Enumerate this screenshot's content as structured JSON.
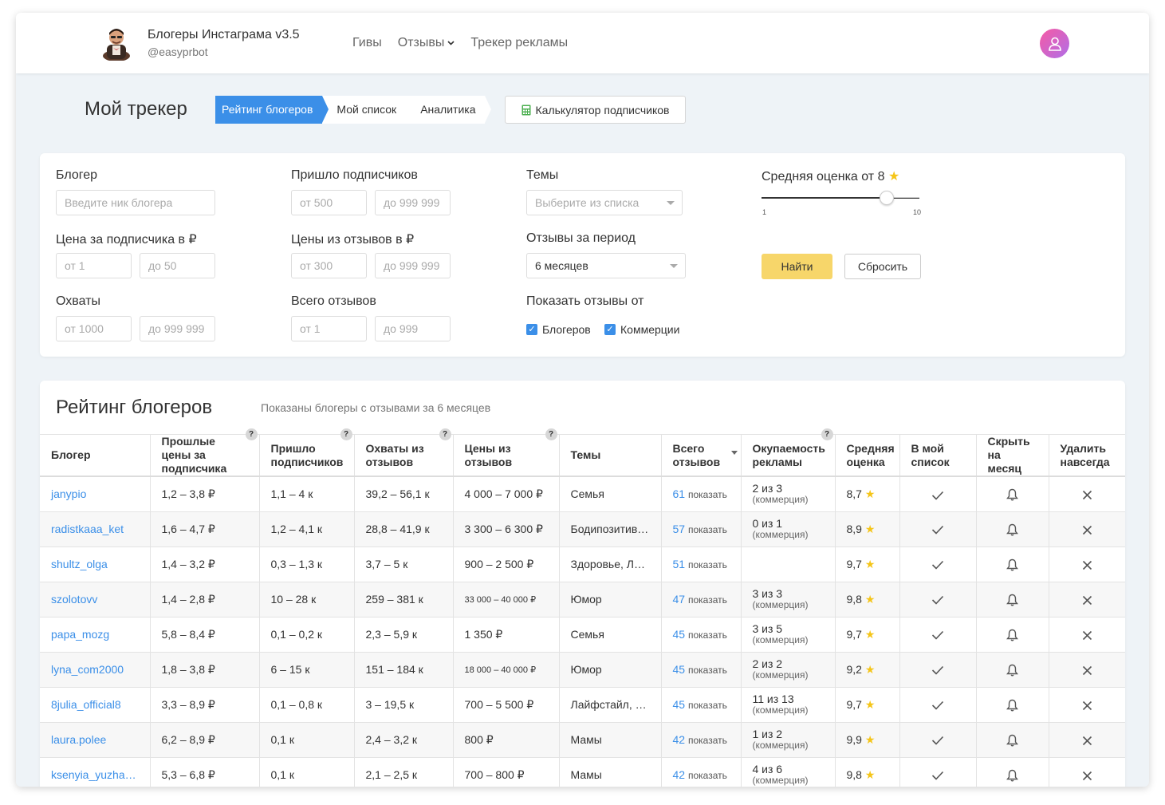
{
  "brand": {
    "title": "Блогеры Инстаграма v3.5",
    "subtitle": "@easyprbot"
  },
  "nav": {
    "items": [
      {
        "label": "Гивы",
        "dropdown": false
      },
      {
        "label": "Отзывы",
        "dropdown": true
      },
      {
        "label": "Трекер рекламы",
        "dropdown": false
      }
    ]
  },
  "page": {
    "title": "Мой трекер",
    "tabs": [
      "Рейтинг блогеров",
      "Мой список",
      "Аналитика"
    ],
    "active_tab": "Рейтинг блогеров",
    "calculator_label": "Калькулятор подписчиков"
  },
  "filters": {
    "blogger_label": "Блогер",
    "blogger_placeholder": "Введите ник блогера",
    "subs_label": "Пришло подписчиков",
    "subs_from": "от 500",
    "subs_to": "до 999 999",
    "themes_label": "Темы",
    "themes_placeholder": "Выберите из списка",
    "avg_label": "Средняя оценка от",
    "avg_value": "8",
    "slider_min": "1",
    "slider_max": "10",
    "slider_value": 8,
    "price_label": "Цена за подписчика в ₽",
    "price_from": "от 1",
    "price_to": "до 50",
    "review_price_label": "Цены из отзывов в ₽",
    "review_price_from": "от 300",
    "review_price_to": "до 999 999",
    "period_label": "Отзывы за период",
    "period_value": "6 месяцев",
    "find_label": "Найти",
    "reset_label": "Сбросить",
    "reach_label": "Охваты",
    "reach_from": "от 1000",
    "reach_to": "до 999 999",
    "total_label": "Всего отзывов",
    "total_from": "от 1",
    "total_to": "до 999",
    "show_from_label": "Показать отзывы от",
    "chk_bloggers": "Блогеров",
    "chk_commerce": "Коммерции"
  },
  "rating": {
    "title": "Рейтинг блогеров",
    "subtitle": "Показаны блогеры с отзывами за 6 месяцев",
    "columns": [
      "Блогер",
      "Прошлые цены за подписчика",
      "Пришло подписчиков",
      "Охваты из отзывов",
      "Цены из отзывов",
      "Темы",
      "Всего отзывов",
      "Окупаемость рекламы",
      "Средняя оценка",
      "В мой список",
      "Скрыть на месяц",
      "Удалить навсегда"
    ],
    "show_label": "показать",
    "commerce_label": "(коммерция)",
    "rows": [
      {
        "blogger": "janypio",
        "past_price": "1,2 – 3,8 ₽",
        "subs": "1,1 – 4 к",
        "reach": "39,2 – 56,1 к",
        "prices": "4 000 – 7 000 ₽",
        "theme": "Семья",
        "total": "61",
        "roi": "2 из 3",
        "score": "8,7"
      },
      {
        "blogger": "radistkaaa_ket",
        "past_price": "1,6 – 4,7 ₽",
        "subs": "1,2 – 4,1 к",
        "reach": "28,8 – 41,9 к",
        "prices": "3 300 – 6 300 ₽",
        "theme": "Бодипозитив…",
        "total": "57",
        "roi": "0 из 1",
        "score": "8,9"
      },
      {
        "blogger": "shultz_olga",
        "past_price": "1,4 – 3,2 ₽",
        "subs": "0,3 – 1,3 к",
        "reach": "3,7 – 5 к",
        "prices": "900 – 2 500 ₽",
        "theme": "Здоровье, Ла…",
        "total": "51",
        "roi": "",
        "score": "9,7"
      },
      {
        "blogger": "szolotovv",
        "past_price": "1,4 – 2,8 ₽",
        "subs": "10 – 28 к",
        "reach": "259 – 381 к",
        "prices": "33 000 – 40 000 ₽",
        "theme": "Юмор",
        "total": "47",
        "roi": "3 из 3",
        "score": "9,8"
      },
      {
        "blogger": "papa_mozg",
        "past_price": "5,8 – 8,4 ₽",
        "subs": "0,1 – 0,2 к",
        "reach": "2,3 – 5,9 к",
        "prices": "1 350 ₽",
        "theme": "Семья",
        "total": "45",
        "roi": "3 из 5",
        "score": "9,7"
      },
      {
        "blogger": "lyna_com2000",
        "past_price": "1,8 – 3,8 ₽",
        "subs": "6 – 15 к",
        "reach": "151 – 184 к",
        "prices": "18 000 – 40 000 ₽",
        "theme": "Юмор",
        "total": "45",
        "roi": "2 из 2",
        "score": "9,2"
      },
      {
        "blogger": "8julia_official8",
        "past_price": "3,3 – 8,9 ₽",
        "subs": "0,1 – 0,8 к",
        "reach": "3 – 19,5 к",
        "prices": "700 – 5 500 ₽",
        "theme": "Лайфстайл, …",
        "total": "45",
        "roi": "11 из 13",
        "score": "9,7"
      },
      {
        "blogger": "laura.polee",
        "past_price": "6,2 – 8,9 ₽",
        "subs": "0,1 к",
        "reach": "2,4 – 3,2 к",
        "prices": "800 ₽",
        "theme": "Мамы",
        "total": "42",
        "roi": "1 из 2",
        "score": "9,9"
      },
      {
        "blogger": "ksenyia_yuzha…",
        "past_price": "5,3 – 6,8 ₽",
        "subs": "0,1 к",
        "reach": "2,1 – 2,5 к",
        "prices": "700 – 800 ₽",
        "theme": "Мамы",
        "total": "42",
        "roi": "4 из 6",
        "score": "9,8"
      }
    ]
  },
  "icons": {
    "star": "star-icon",
    "check": "check-icon",
    "bell": "bell-icon",
    "close": "close-icon",
    "calculator": "calculator-icon",
    "user": "user-icon"
  },
  "colors": {
    "accent": "#3b8fe8",
    "find_button": "#f7d66a",
    "star": "#f5c518",
    "background": "#eef3f7"
  }
}
